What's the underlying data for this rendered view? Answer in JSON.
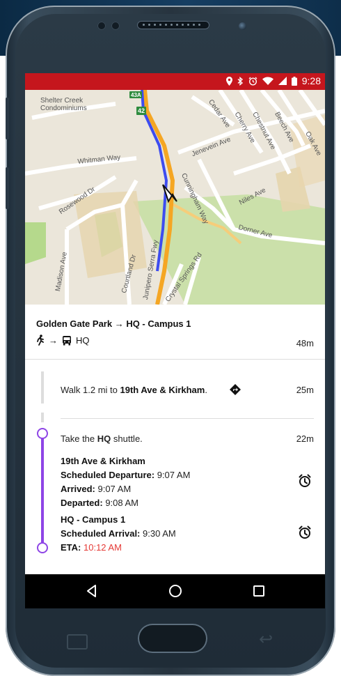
{
  "status_bar": {
    "time": "9:28",
    "icons": [
      "location-icon",
      "bluetooth-icon",
      "alarm-icon",
      "wifi-icon",
      "signal-icon",
      "battery-icon"
    ]
  },
  "map": {
    "labels": {
      "shelter_creek": "Shelter Creek\nCondominiums",
      "whitman_way": "Whitman Way",
      "rosewood_dr": "Rosewood Dr",
      "madison_ave": "Madison Ave",
      "courtland_dr": "Courtland Dr",
      "junipero_serra_fwy": "Junipero Serra Fwy",
      "crystal_springs_rd": "Crystal Springs Rd",
      "cedar_ave": "Cedar Ave",
      "cherry_ave": "Cherry Ave",
      "chestnut_ave": "Chestnut Ave",
      "beech_ave": "Beech Ave",
      "oak_ave": "Oak Ave",
      "jenevein_ave": "Jenevein Ave",
      "cunningham_way": "Cunningham Way",
      "niles_ave": "Niles Ave",
      "dorner_ave": "Dorner Ave",
      "shield_43a": "43A",
      "shield_42": "42"
    }
  },
  "route": {
    "title": "Golden Gate Park → HQ - Campus 1",
    "mode_arrow": "→",
    "mode_label": "HQ",
    "duration": "48m"
  },
  "walk_step": {
    "prefix": "Walk 1.2 mi to ",
    "destination": "19th Ave & Kirkham",
    "suffix": ".",
    "duration": "25m"
  },
  "shuttle_step": {
    "prefix": "Take the ",
    "name": "HQ",
    "suffix": " shuttle.",
    "duration": "22m",
    "departure_stop": {
      "name": "19th Ave & Kirkham",
      "scheduled_departure_label": "Scheduled Departure:",
      "scheduled_departure": "9:07 AM",
      "arrived_label": "Arrived:",
      "arrived": "9:07 AM",
      "departed_label": "Departed:",
      "departed": "9:08 AM"
    },
    "arrival_stop": {
      "name": "HQ - Campus 1",
      "scheduled_arrival_label": "Scheduled Arrival:",
      "scheduled_arrival": "9:30 AM",
      "eta_label": "ETA:",
      "eta": "10:12 AM"
    }
  },
  "colors": {
    "status_bar": "#c5161d",
    "shuttle_line": "#8e45e6",
    "eta": "#e53935",
    "route_blue": "#3d4cf0",
    "route_orange": "#f5a623"
  }
}
